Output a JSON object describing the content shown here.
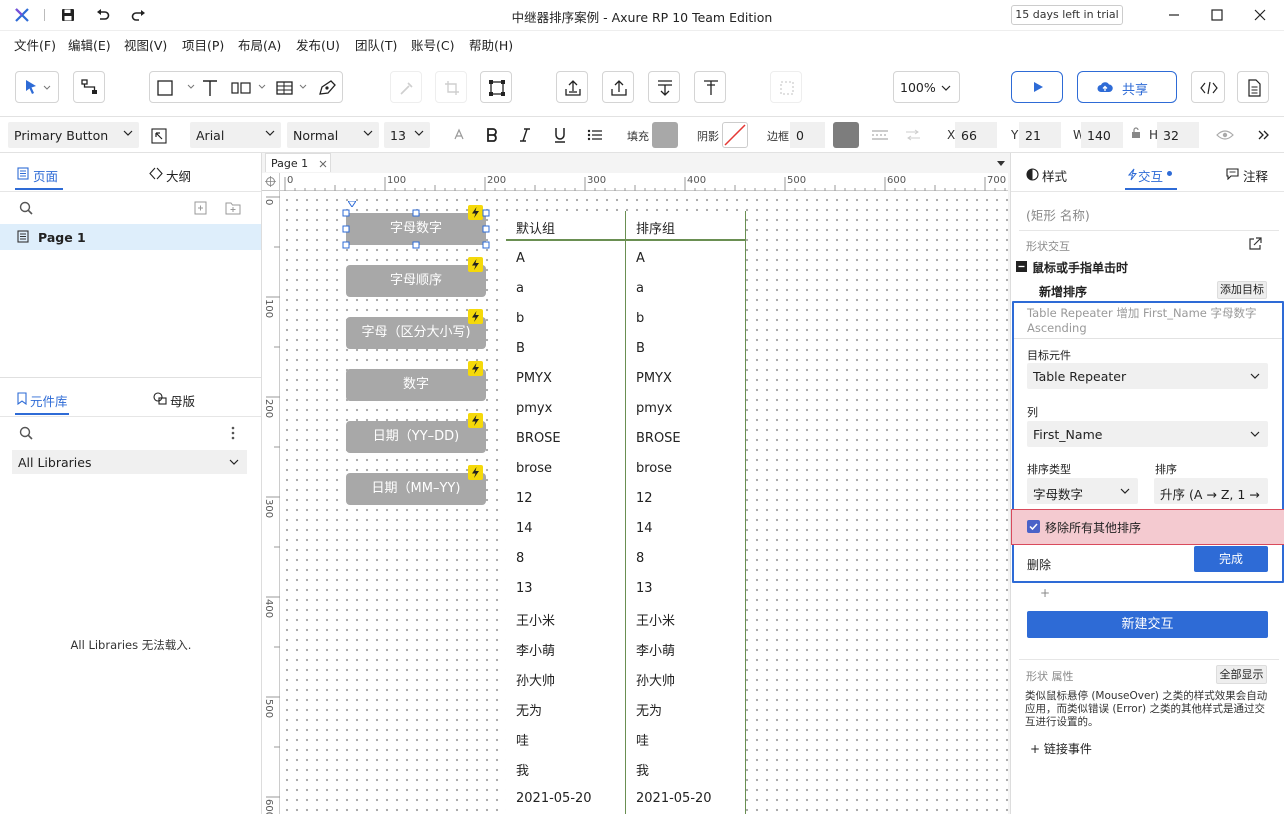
{
  "window": {
    "title": "中继器排序案例 - Axure RP 10 Team Edition",
    "trial_badge": "15 days left in trial"
  },
  "menu": [
    "文件(F)",
    "编辑(E)",
    "视图(V)",
    "项目(P)",
    "布局(A)",
    "发布(U)",
    "团队(T)",
    "账号(C)",
    "帮助(H)"
  ],
  "toolbar": {
    "zoom": "100%",
    "share_label": "共享"
  },
  "format": {
    "widget_style": "Primary Button",
    "font_family": "Arial",
    "font_weight": "Normal",
    "font_size": "13",
    "fill_label": "填充",
    "fill_color": "#a8a8a8",
    "shadow_label": "阴影",
    "border_label": "边框",
    "border_width": "0",
    "border_color": "#7d7d7d",
    "x_label": "X",
    "x": "66",
    "y_label": "Y",
    "y": "21",
    "w_label": "W",
    "w": "140",
    "h_label": "H",
    "h": "32"
  },
  "left_panel": {
    "tab_pages": "页面",
    "tab_outline": "大纲",
    "page_item": "Page 1",
    "tab_library": "元件库",
    "tab_masters": "母版",
    "library_select": "All Libraries",
    "library_message": "All Libraries 无法载入."
  },
  "canvas": {
    "page_tab": "Page 1",
    "ruler_x": [
      "0",
      "100",
      "200",
      "300",
      "400",
      "500",
      "600",
      "700"
    ],
    "ruler_y": [
      "0",
      "100",
      "200",
      "300",
      "400",
      "500",
      "600"
    ],
    "buttons": [
      "字母数字",
      "字母顺序",
      "字母（区分大小写)",
      "数字",
      "日期（YY–DD)",
      "日期（MM–YY)"
    ],
    "repeater_default_header": "默认组",
    "repeater_sorted_header": "排序组",
    "rows": [
      "A",
      "a",
      "b",
      "B",
      "PMYX",
      "pmyx",
      "BROSE",
      "brose",
      "12",
      "14",
      "8",
      "13",
      "王小米",
      "李小萌",
      "孙大帅",
      "无为",
      "哇",
      "我",
      "2021-05-20"
    ]
  },
  "right_panel": {
    "tab_style": "样式",
    "tab_interaction": "交互",
    "tab_notes": "注释",
    "shape_name_placeholder": "(矩形 名称)",
    "shape_interaction_label": "形状交互",
    "event_label": "鼠标或手指单击时",
    "action_label": "新增排序",
    "add_target_label": "添加目标",
    "action_summary": "Table Repeater 增加 First_Name 字母数字 Ascending",
    "target_label": "目标元件",
    "target_value": "Table Repeater",
    "column_label": "列",
    "column_value": "First_Name",
    "sort_type_label": "排序类型",
    "sort_type_value": "字母数字",
    "sort_order_label": "排序",
    "sort_order_value": "升序 (A → Z, 1 →",
    "remove_others_label": "移除所有其他排序",
    "remove_others_checked": true,
    "delete_label": "删除",
    "done_label": "完成",
    "plus_label": "+",
    "new_interaction_label": "新建交互",
    "shape_props_label": "形状 属性",
    "show_all_label": "全部显示",
    "hint_text": "类似鼠标悬停 (MouseOver) 之类的样式效果会自动应用，而类似错误 (Error) 之类的其他样式是通过交互进行设置的。",
    "link_event_label": "+ 链接事件"
  },
  "colors": {
    "accent": "#2e6bd6",
    "button_fill": "#a8a8a8",
    "repeater_line": "#6a8f52",
    "highlight_row": "#f4cad0",
    "highlight_border": "#d94a5c",
    "bolt": "#f5d90a"
  }
}
